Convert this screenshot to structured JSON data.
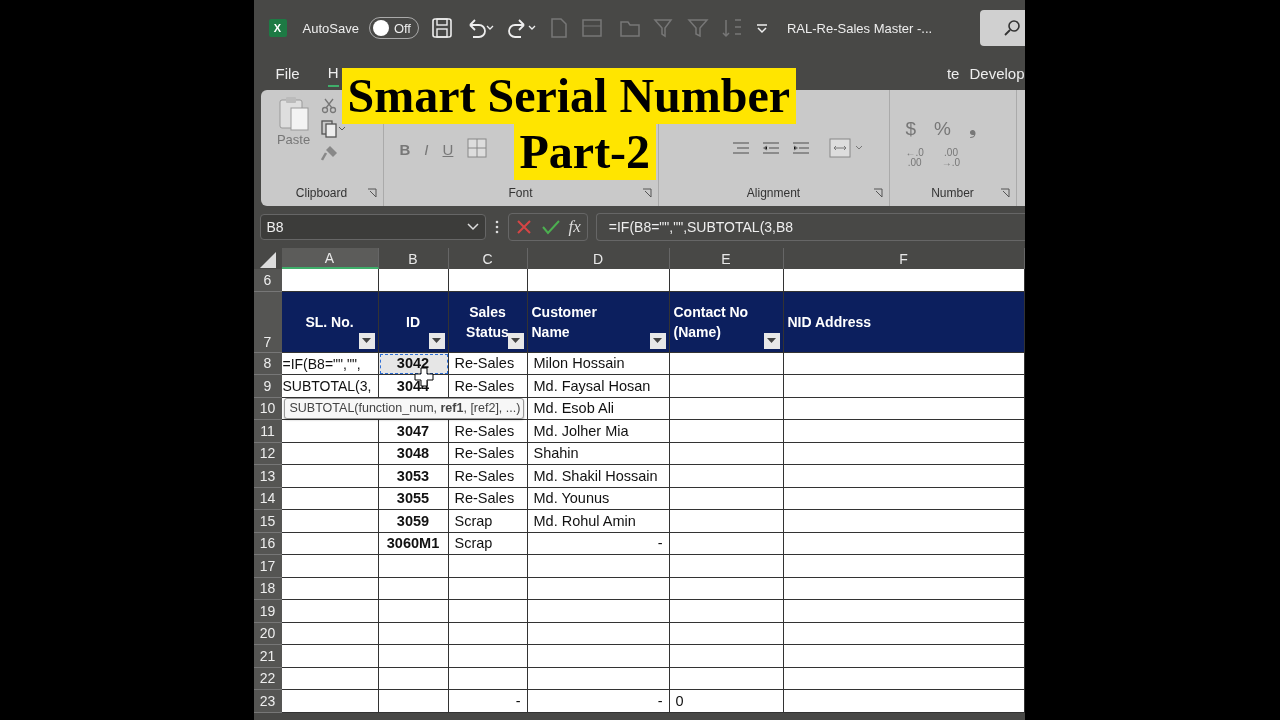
{
  "title_bar": {
    "app_icon_letter": "X",
    "autosave_label": "AutoSave",
    "autosave_toggle": {
      "label": "Off",
      "on": false
    },
    "document_title": "RAL-Re-Sales Master  -..."
  },
  "menu_tabs": [
    {
      "label": "File",
      "selected": false
    },
    {
      "label": "H",
      "selected": true
    },
    {
      "label": "te",
      "selected": false
    },
    {
      "label": "Develop",
      "selected": false
    }
  ],
  "ribbon": {
    "paste_label": "Paste",
    "font_buttons": [
      "B",
      "I",
      "U"
    ],
    "currency_symbol": "$",
    "percent_symbol": "%",
    "comma_symbol": "❟",
    "decimal_buttons": [
      {
        "top": "←.0",
        "bottom": ".00"
      },
      {
        "top": ".00",
        "bottom": "→.0"
      }
    ],
    "groups": [
      {
        "label": "Clipboard"
      },
      {
        "label": "Font"
      },
      {
        "label": "Alignment"
      },
      {
        "label": "Number"
      }
    ]
  },
  "banner": {
    "lines": [
      "Smart Serial Number",
      "Part-2"
    ]
  },
  "formula_bar": {
    "name_box": "B8",
    "fx": "fx",
    "formula": "=IF(B8=\"\",\"\",SUBTOTAL(3,B8"
  },
  "sheet": {
    "columns": [
      {
        "letter": "A",
        "selected": true
      },
      {
        "letter": "B",
        "selected": false
      },
      {
        "letter": "C",
        "selected": false
      },
      {
        "letter": "D",
        "selected": false
      },
      {
        "letter": "E",
        "selected": false
      },
      {
        "letter": "F",
        "selected": false
      }
    ],
    "header_row": {
      "number": "7",
      "labels": [
        {
          "label": "SL. No.",
          "centered": true,
          "filter": true
        },
        {
          "label": "ID",
          "centered": true,
          "filter": true
        },
        {
          "label": "Sales Status",
          "centered": true,
          "filter": true
        },
        {
          "label": "Customer Name",
          "centered": false,
          "filter": true
        },
        {
          "label": "Contact No (Name)",
          "centered": false,
          "filter": true
        },
        {
          "label": "NID Address",
          "centered": false,
          "filter": false
        }
      ]
    },
    "rows_before": [
      {
        "number": "6"
      }
    ],
    "rows": [
      {
        "number": "8",
        "cells": [
          null,
          {
            "text": "3042",
            "selected": true
          },
          {
            "text": "Re-Sales",
            "selected": false
          },
          {
            "text": "Milon Hossain",
            "selected": false
          },
          null,
          null
        ]
      },
      {
        "number": "9",
        "cells": [
          null,
          {
            "text": "3044",
            "selected": false
          },
          {
            "text": "Re-Sales",
            "selected": false
          },
          {
            "text": "Md. Faysal Hosan",
            "selected": false
          },
          null,
          null
        ]
      },
      {
        "number": "10",
        "cells": [
          null,
          null,
          null,
          {
            "text": "Md. Esob Ali",
            "selected": false
          },
          null,
          null
        ]
      },
      {
        "number": "11",
        "cells": [
          null,
          {
            "text": "3047",
            "selected": false
          },
          {
            "text": "Re-Sales",
            "selected": false
          },
          {
            "text": "Md. Jolher Mia",
            "selected": false
          },
          null,
          null
        ]
      },
      {
        "number": "12",
        "cells": [
          null,
          {
            "text": "3048",
            "selected": false
          },
          {
            "text": "Re-Sales",
            "selected": false
          },
          {
            "text": "Shahin",
            "selected": false
          },
          null,
          null
        ]
      },
      {
        "number": "13",
        "cells": [
          null,
          {
            "text": "3053",
            "selected": false
          },
          {
            "text": "Re-Sales",
            "selected": false
          },
          {
            "text": "Md. Shakil Hossain",
            "selected": false
          },
          null,
          null
        ]
      },
      {
        "number": "14",
        "cells": [
          null,
          {
            "text": "3055",
            "selected": false
          },
          {
            "text": "Re-Sales",
            "selected": false
          },
          {
            "text": "Md. Younus",
            "selected": false
          },
          null,
          null
        ]
      },
      {
        "number": "15",
        "cells": [
          null,
          {
            "text": "3059",
            "selected": false
          },
          {
            "text": "Scrap",
            "selected": false
          },
          {
            "text": "Md. Rohul Amin",
            "selected": false
          },
          null,
          null
        ]
      },
      {
        "number": "16",
        "cells": [
          null,
          {
            "text": "3060M1",
            "selected": false
          },
          {
            "text": "Scrap",
            "selected": false
          },
          {
            "text": "-",
            "selected": false,
            "align_right": true
          },
          null,
          null
        ]
      },
      {
        "number": "17"
      },
      {
        "number": "18"
      },
      {
        "number": "19"
      },
      {
        "number": "20"
      },
      {
        "number": "21"
      },
      {
        "number": "22"
      },
      {
        "number": "23",
        "cells": [
          null,
          null,
          {
            "text": "-",
            "selected": false,
            "align_right": true
          },
          {
            "text": "-",
            "selected": false,
            "align_right": true
          },
          {
            "text": "0",
            "selected": false
          },
          null
        ]
      }
    ],
    "cell_editor": {
      "lines": [
        "=IF(B8=\"\",\"\",",
        "SUBTOTAL(3,"
      ]
    },
    "tooltip": "SUBTOTAL(function_num, **ref1**, [ref2], ...)"
  }
}
